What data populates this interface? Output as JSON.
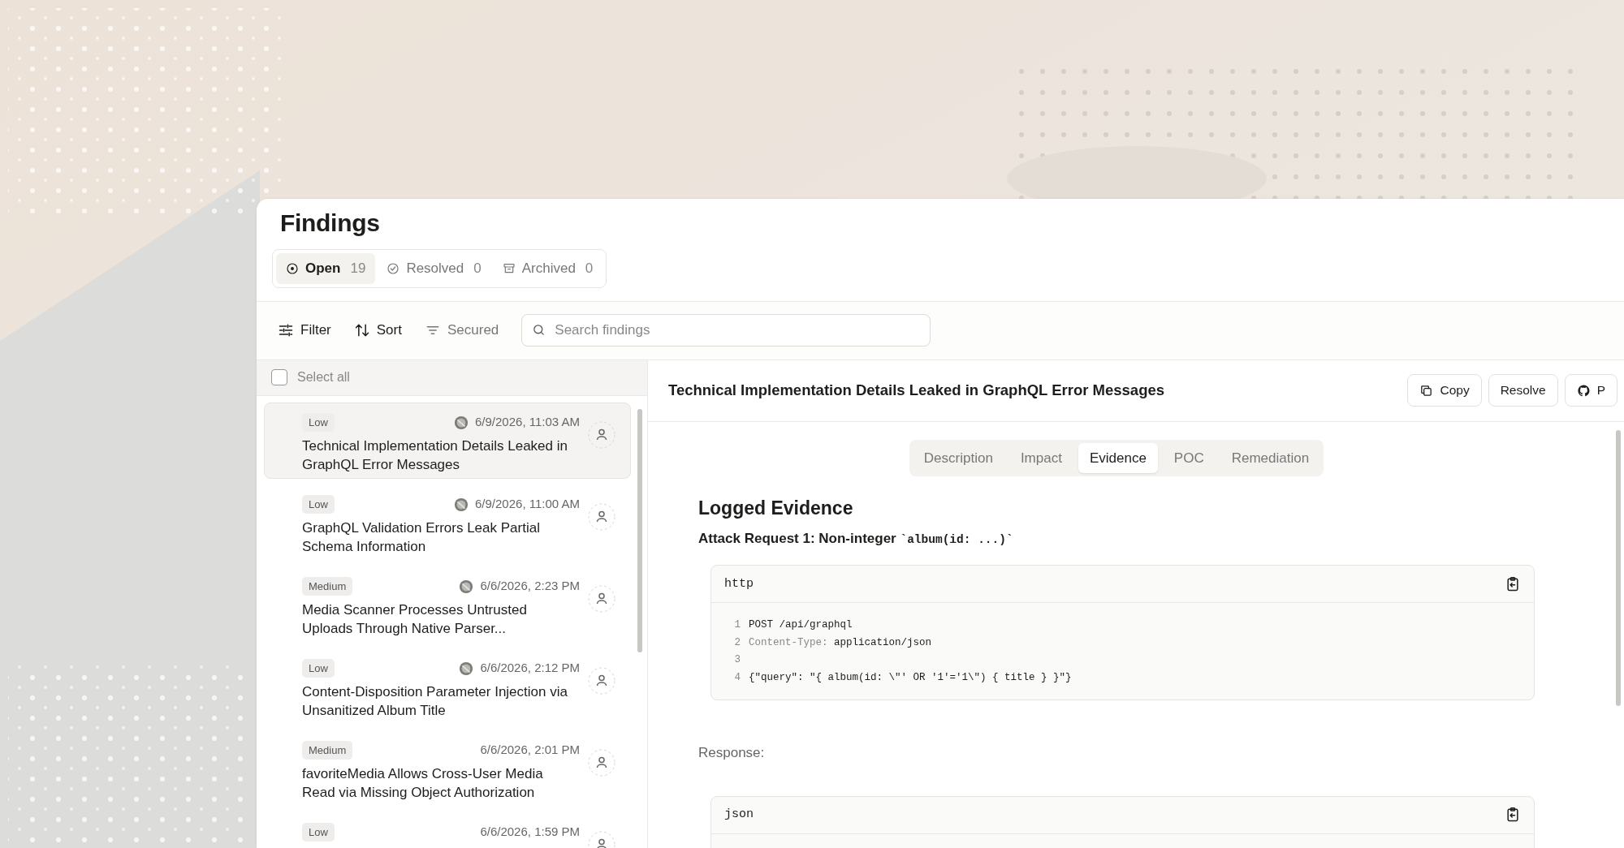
{
  "page": {
    "title": "Findings"
  },
  "status_tabs": [
    {
      "label": "Open",
      "count": "19",
      "kind": "open",
      "selected": true
    },
    {
      "label": "Resolved",
      "count": "0",
      "kind": "resolved",
      "selected": false
    },
    {
      "label": "Archived",
      "count": "0",
      "kind": "archived",
      "selected": false
    }
  ],
  "toolbar": {
    "filter": "Filter",
    "sort": "Sort",
    "secured": "Secured",
    "search": {
      "placeholder": "Search findings"
    }
  },
  "list": {
    "select_all": {
      "label": "Select all",
      "checked": false
    },
    "items": [
      {
        "severity": "Low",
        "date": "6/9/2026, 11:03 AM",
        "source_icon": true,
        "title": "Technical Implementation Details Leaked in GraphQL Error Messages",
        "selected": true
      },
      {
        "severity": "Low",
        "date": "6/9/2026, 11:00 AM",
        "source_icon": true,
        "title": "GraphQL Validation Errors Leak Partial Schema Information",
        "selected": false
      },
      {
        "severity": "Medium",
        "date": "6/6/2026, 2:23 PM",
        "source_icon": true,
        "title": "Media Scanner Processes Untrusted Uploads Through Native Parser...",
        "selected": false
      },
      {
        "severity": "Low",
        "date": "6/6/2026, 2:12 PM",
        "source_icon": true,
        "title": "Content-Disposition Parameter Injection via Unsanitized Album Title",
        "selected": false
      },
      {
        "severity": "Medium",
        "date": "6/6/2026, 2:01 PM",
        "source_icon": false,
        "title": "favoriteMedia Allows Cross-User Media Read via Missing Object Authorization",
        "selected": false
      },
      {
        "severity": "Low",
        "date": "6/6/2026, 1:59 PM",
        "source_icon": false,
        "selected": false
      }
    ]
  },
  "detail": {
    "title": "Technical Implementation Details Leaked in GraphQL Error Messages",
    "actions": [
      {
        "label": "Copy",
        "kind": "copy"
      },
      {
        "label": "Resolve",
        "kind": "plain"
      },
      {
        "label": "P",
        "kind": "github"
      }
    ],
    "tabs": [
      {
        "label": "Description",
        "selected": false
      },
      {
        "label": "Impact",
        "selected": false
      },
      {
        "label": "Evidence",
        "selected": true
      },
      {
        "label": "POC",
        "selected": false
      },
      {
        "label": "Remediation",
        "selected": false
      }
    ],
    "heading": "Logged Evidence",
    "subheading": {
      "text": "Attack Request 1: Non-integer",
      "code": "`album(id: ...)`"
    },
    "blocks": [
      {
        "kind": "code",
        "language": "http",
        "lines": [
          {
            "number": "1",
            "tokens": [
              {
                "kind": "plain",
                "text": "POST /api/graphql"
              }
            ]
          },
          {
            "number": "2",
            "tokens": [
              {
                "kind": "key",
                "text": "Content-Type:"
              },
              {
                "kind": "plain",
                "text": " application/json"
              }
            ]
          },
          {
            "number": "3"
          },
          {
            "number": "4",
            "tokens": [
              {
                "kind": "plain",
                "text": "{\"query\": \"{ album(id: \\\"' OR '1'='1\\\") { title } }\"}"
              }
            ]
          }
        ]
      },
      {
        "kind": "text",
        "text": "Response:"
      },
      {
        "kind": "code",
        "language": "json"
      }
    ]
  }
}
